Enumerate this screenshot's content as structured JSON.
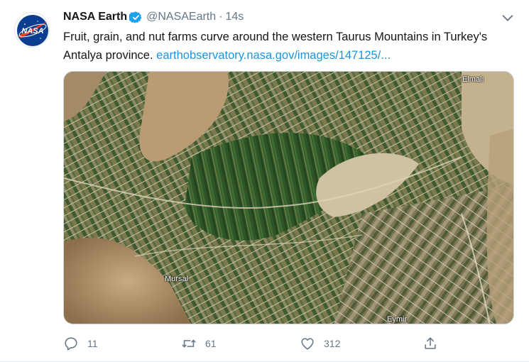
{
  "tweet": {
    "author_name": "NASA Earth",
    "handle": "@NASAEarth",
    "separator": "·",
    "time": "14s",
    "text_main": "Fruit, grain, and nut farms curve around the western Taurus Mountains in Turkey's Antalya province.",
    "link_text": "earthobservatory.nasa.gov/images/147125/...",
    "image": {
      "labels": {
        "top_right": "Elmalı",
        "left": "Mursal",
        "bottom": "Eymir"
      }
    },
    "actions": {
      "reply_count": "11",
      "retweet_count": "61",
      "like_count": "312"
    },
    "icons": {
      "verified": "verified-badge-icon",
      "more": "chevron-down-icon",
      "reply": "reply-icon",
      "retweet": "retweet-icon",
      "like": "heart-icon",
      "share": "share-icon"
    },
    "colors": {
      "accent": "#1da1f2",
      "link": "#1b95e0",
      "muted": "#657786"
    }
  }
}
